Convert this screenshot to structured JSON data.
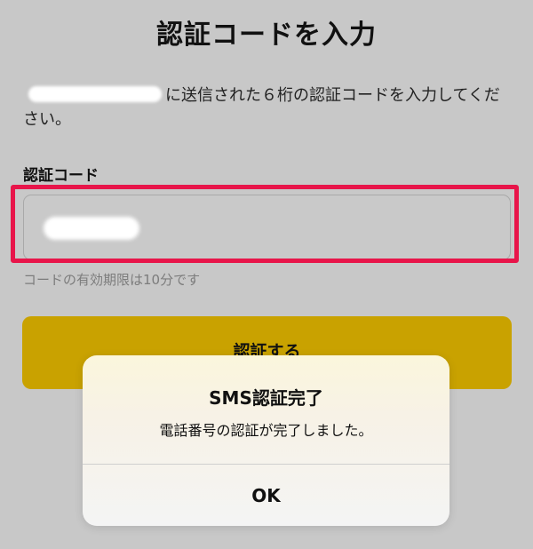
{
  "page": {
    "title": "認証コードを入力"
  },
  "instruction": {
    "text": "に送信された６桁の認証コードを入力してください。"
  },
  "form": {
    "label": "認証コード",
    "hint": "コードの有効期限は10分です"
  },
  "button": {
    "label": "認証する"
  },
  "alert": {
    "title": "SMS認証完了",
    "message": "電話番号の認証が完了しました。",
    "ok_label": "OK"
  },
  "colors": {
    "background": "#c8c8c8",
    "button": "#c9a200",
    "highlight": "#e8154a"
  }
}
